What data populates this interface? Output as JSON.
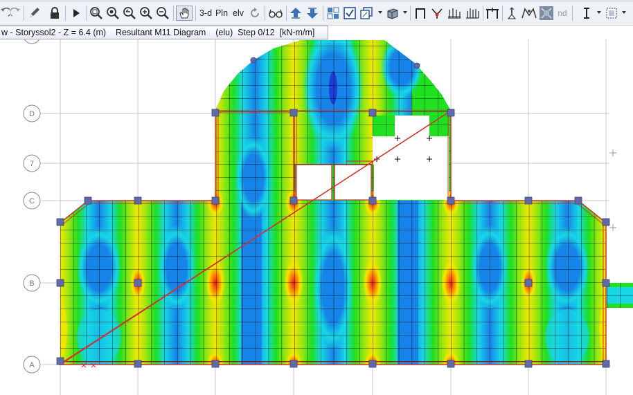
{
  "tab": {
    "title": "w - Storyssol2 - Z = 6.4 (m)    Resultant M11 Diagram    (elu)  Step 0/12  [kN-m/m]"
  },
  "toolbar": {
    "buttons": [
      {
        "name": "undo-button",
        "icon": "undo-icon"
      },
      {
        "name": "redo-button",
        "icon": "redo-icon"
      },
      {
        "name": "draw-button",
        "icon": "pencil-icon"
      },
      {
        "name": "lock-button",
        "icon": "lock-icon"
      },
      {
        "name": "run-button",
        "icon": "play-icon"
      },
      {
        "name": "zoom-window-button",
        "icon": "zoom-window-icon"
      },
      {
        "name": "zoom-restore-button",
        "icon": "zoom-restore-icon"
      },
      {
        "name": "zoom-previous-button",
        "icon": "zoom-previous-icon"
      },
      {
        "name": "zoom-in-button",
        "icon": "zoom-in-icon"
      },
      {
        "name": "zoom-out-button",
        "icon": "zoom-out-icon"
      },
      {
        "name": "pan-button",
        "icon": "hand-icon"
      },
      {
        "name": "view-3d-button",
        "icon": "3d-icon"
      },
      {
        "name": "view-plan-button",
        "icon": "plan-icon"
      },
      {
        "name": "view-elevation-button",
        "icon": "elevation-icon"
      },
      {
        "name": "rotate-button",
        "icon": "rotate-icon"
      },
      {
        "name": "perspective-button",
        "icon": "glasses-icon"
      },
      {
        "name": "move-up-button",
        "icon": "arrow-up-icon"
      },
      {
        "name": "move-down-button",
        "icon": "arrow-down-icon"
      },
      {
        "name": "select-button",
        "icon": "select-icon"
      },
      {
        "name": "check-button",
        "icon": "checkbox-icon"
      },
      {
        "name": "object-button",
        "icon": "object-icon"
      },
      {
        "name": "shading-button",
        "icon": "cube-icon"
      },
      {
        "name": "frame-button",
        "icon": "frame-icon"
      },
      {
        "name": "joint-button",
        "icon": "joint-icon"
      },
      {
        "name": "slab-button",
        "icon": "slab-icon"
      },
      {
        "name": "wall-button",
        "icon": "wall-icon"
      },
      {
        "name": "column-button",
        "icon": "column-icon"
      },
      {
        "name": "restraint-button",
        "icon": "restraint-icon"
      },
      {
        "name": "spring-button",
        "icon": "spring-icon"
      },
      {
        "name": "mesh-button",
        "icon": "mesh-icon"
      },
      {
        "name": "text-button",
        "icon": "text-cursor-icon"
      },
      {
        "name": "snap-button",
        "icon": "snap-icon"
      }
    ],
    "labels": {
      "three_d": "3-d",
      "plan": "Pln",
      "elevation": "elv",
      "nd": "nd"
    }
  },
  "grid": {
    "rows": [
      "D",
      "7",
      "C",
      "B",
      "A"
    ],
    "colors": {
      "bubble": "#8a8a8a",
      "line": "#c8c8c8"
    }
  },
  "diagram": {
    "quantity": "M11",
    "colors": {
      "deep_blue": "#1d3fd8",
      "blue": "#1684e8",
      "cyan": "#17d7e6",
      "green": "#1fe11f",
      "yellow_green": "#a2e60f",
      "yellow": "#f4e600",
      "orange": "#ff7f00",
      "red": "#e52222",
      "mesh": "#000000",
      "slab_edge": "#d43030",
      "joint": "#606aa8"
    }
  }
}
